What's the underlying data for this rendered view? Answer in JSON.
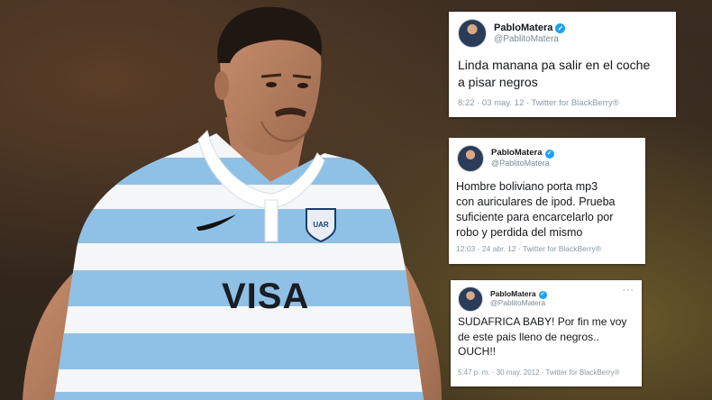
{
  "photo": {
    "subject": "rugby player in light-blue and white striped jersey",
    "jersey_text": "VISA",
    "colors": {
      "stripe_blue": "#8fc1e6",
      "stripe_white": "#f4f6f8",
      "background": "#3a2a1e"
    }
  },
  "tweets": [
    {
      "name": "PabloMatera",
      "handle": "@PablitoMatera",
      "text": "Linda manana pa salir en el coche\na pisar negros",
      "meta": "8:22 · 03 may. 12 · Twitter for BlackBerry®",
      "verified_icon": "✓"
    },
    {
      "name": "PabloMatera",
      "handle": "@PablitoMatera",
      "text": "Hombre boliviano porta mp3\ncon auriculares de ipod. Prueba\nsuficiente para encarcelarlo por\nrobo y perdida del mismo",
      "meta": "12:03 · 24 abr. 12 · Twitter for BlackBerry®",
      "verified_icon": "✓"
    },
    {
      "name": "PabloMatera",
      "handle": "@PablitoMatera",
      "text": "SUDAFRICA BABY! Por fin me voy\nde este pais lleno de negros..\nOUCH!!",
      "meta": "5:47 p. m. · 30 may. 2012 · Twitter for BlackBerry®",
      "menu": "···",
      "verified_icon": "✓"
    }
  ]
}
